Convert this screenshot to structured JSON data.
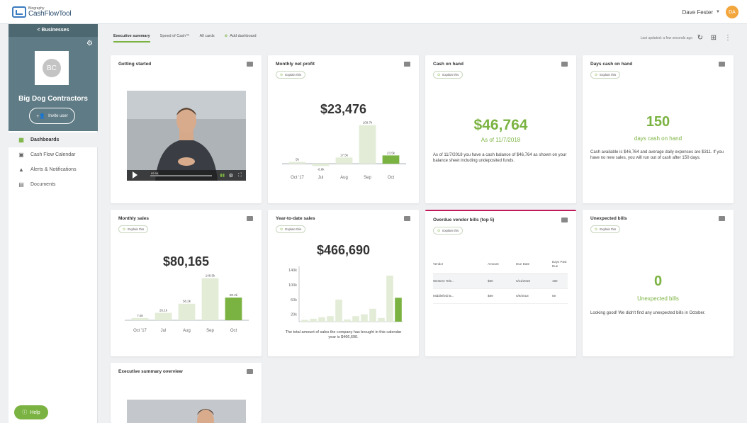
{
  "app": {
    "logo_small": "Biography",
    "logo_big": "CashFlowTool",
    "user_name": "Dave Fester",
    "user_initials": "DA"
  },
  "sidebar": {
    "back_label": "< Businesses",
    "company_initials": "BC",
    "company_name": "Big Dog Contractors",
    "invite_label": "Invite user",
    "items": [
      {
        "label": "Dashboards",
        "icon": "dashboard-grid-icon"
      },
      {
        "label": "Cash Flow Calendar",
        "icon": "calendar-icon"
      },
      {
        "label": "Alerts & Notifications",
        "icon": "bell-icon"
      },
      {
        "label": "Documents",
        "icon": "document-icon"
      }
    ],
    "help_label": "Help"
  },
  "tabs": [
    {
      "label": "Executive summary",
      "active": true
    },
    {
      "label": "Speed of Cash™",
      "active": false
    },
    {
      "label": "All cards",
      "active": false
    }
  ],
  "add_dashboard": "Add dashboard",
  "last_updated": "Last updated: a few seconds ago",
  "explain_label": "Explain this",
  "colors": {
    "accent": "#7bb342",
    "sidebar": "#5f7b85",
    "avatar": "#f2a63b",
    "alert_top": "#c2185b"
  },
  "cards": {
    "getting_started": {
      "title": "Getting started",
      "timestamp": "02:34"
    },
    "monthly_net_profit": {
      "title": "Monthly net profit",
      "value": "$23,476"
    },
    "cash_on_hand": {
      "title": "Cash on hand",
      "value": "$46,764",
      "as_of": "As of 11/7/2018",
      "description": "As of 11/7/2018 you have a cash balance of $46,764 as shown on your balance sheet including undeposited funds."
    },
    "days_cash": {
      "title": "Days cash on hand",
      "value": "150",
      "unit": "days cash on hand",
      "description": "Cash available is $46,764 and average daily expenses are $311. If you have no new sales, you will run out of cash after 150 days."
    },
    "monthly_sales": {
      "title": "Monthly sales",
      "value": "$80,165"
    },
    "ytd_sales": {
      "title": "Year-to-date sales",
      "value": "$466,690",
      "description": "The total amount of sales the company has brought in this calendar year is $466,690."
    },
    "overdue_bills": {
      "title": "Overdue vendor bills (top 5)",
      "headers": [
        "Vendor",
        "Amount",
        "Due Date",
        "Days Past Due"
      ],
      "rows": [
        [
          "Western Tele...",
          "$50",
          "5/11/2018",
          "180"
        ],
        [
          "Middlefield B...",
          "$89",
          "6/9/2018",
          "59"
        ]
      ]
    },
    "unexpected_bills": {
      "title": "Unexpected bills",
      "value": "0",
      "unit": "Unexpected bills",
      "description": "Looking good! We didn't find any unexpected bills in October."
    },
    "exec_overview": {
      "title": "Executive summary overview"
    }
  },
  "chart_data": [
    {
      "type": "bar",
      "title": "Monthly net profit",
      "categories": [
        "Oct '17",
        "Jul",
        "Aug",
        "Sep",
        "Oct"
      ],
      "values": [
        5,
        -6.6,
        17.5,
        109.7,
        23.5
      ],
      "labels": [
        "5k",
        "-6.6k",
        "17.5k",
        "109.7k",
        "23.5k"
      ],
      "ylim": [
        -10,
        115
      ]
    },
    {
      "type": "bar",
      "title": "Monthly sales",
      "categories": [
        "Oct '17",
        "Jul",
        "Aug",
        "Sep",
        "Oct"
      ],
      "values": [
        7.6,
        26.1,
        58.2,
        148.5,
        80.2
      ],
      "labels": [
        "7.6k",
        "26.1k",
        "58.2k",
        "148.5k",
        "80.2k"
      ],
      "ylim": [
        0,
        155
      ]
    },
    {
      "type": "bar",
      "title": "Year-to-date sales",
      "yticks": [
        "20k",
        "60k",
        "100k",
        "140k"
      ],
      "values": [
        5,
        8,
        12,
        15,
        60,
        6,
        15,
        20,
        35,
        10,
        125,
        65
      ],
      "ylim": [
        0,
        150
      ]
    }
  ]
}
